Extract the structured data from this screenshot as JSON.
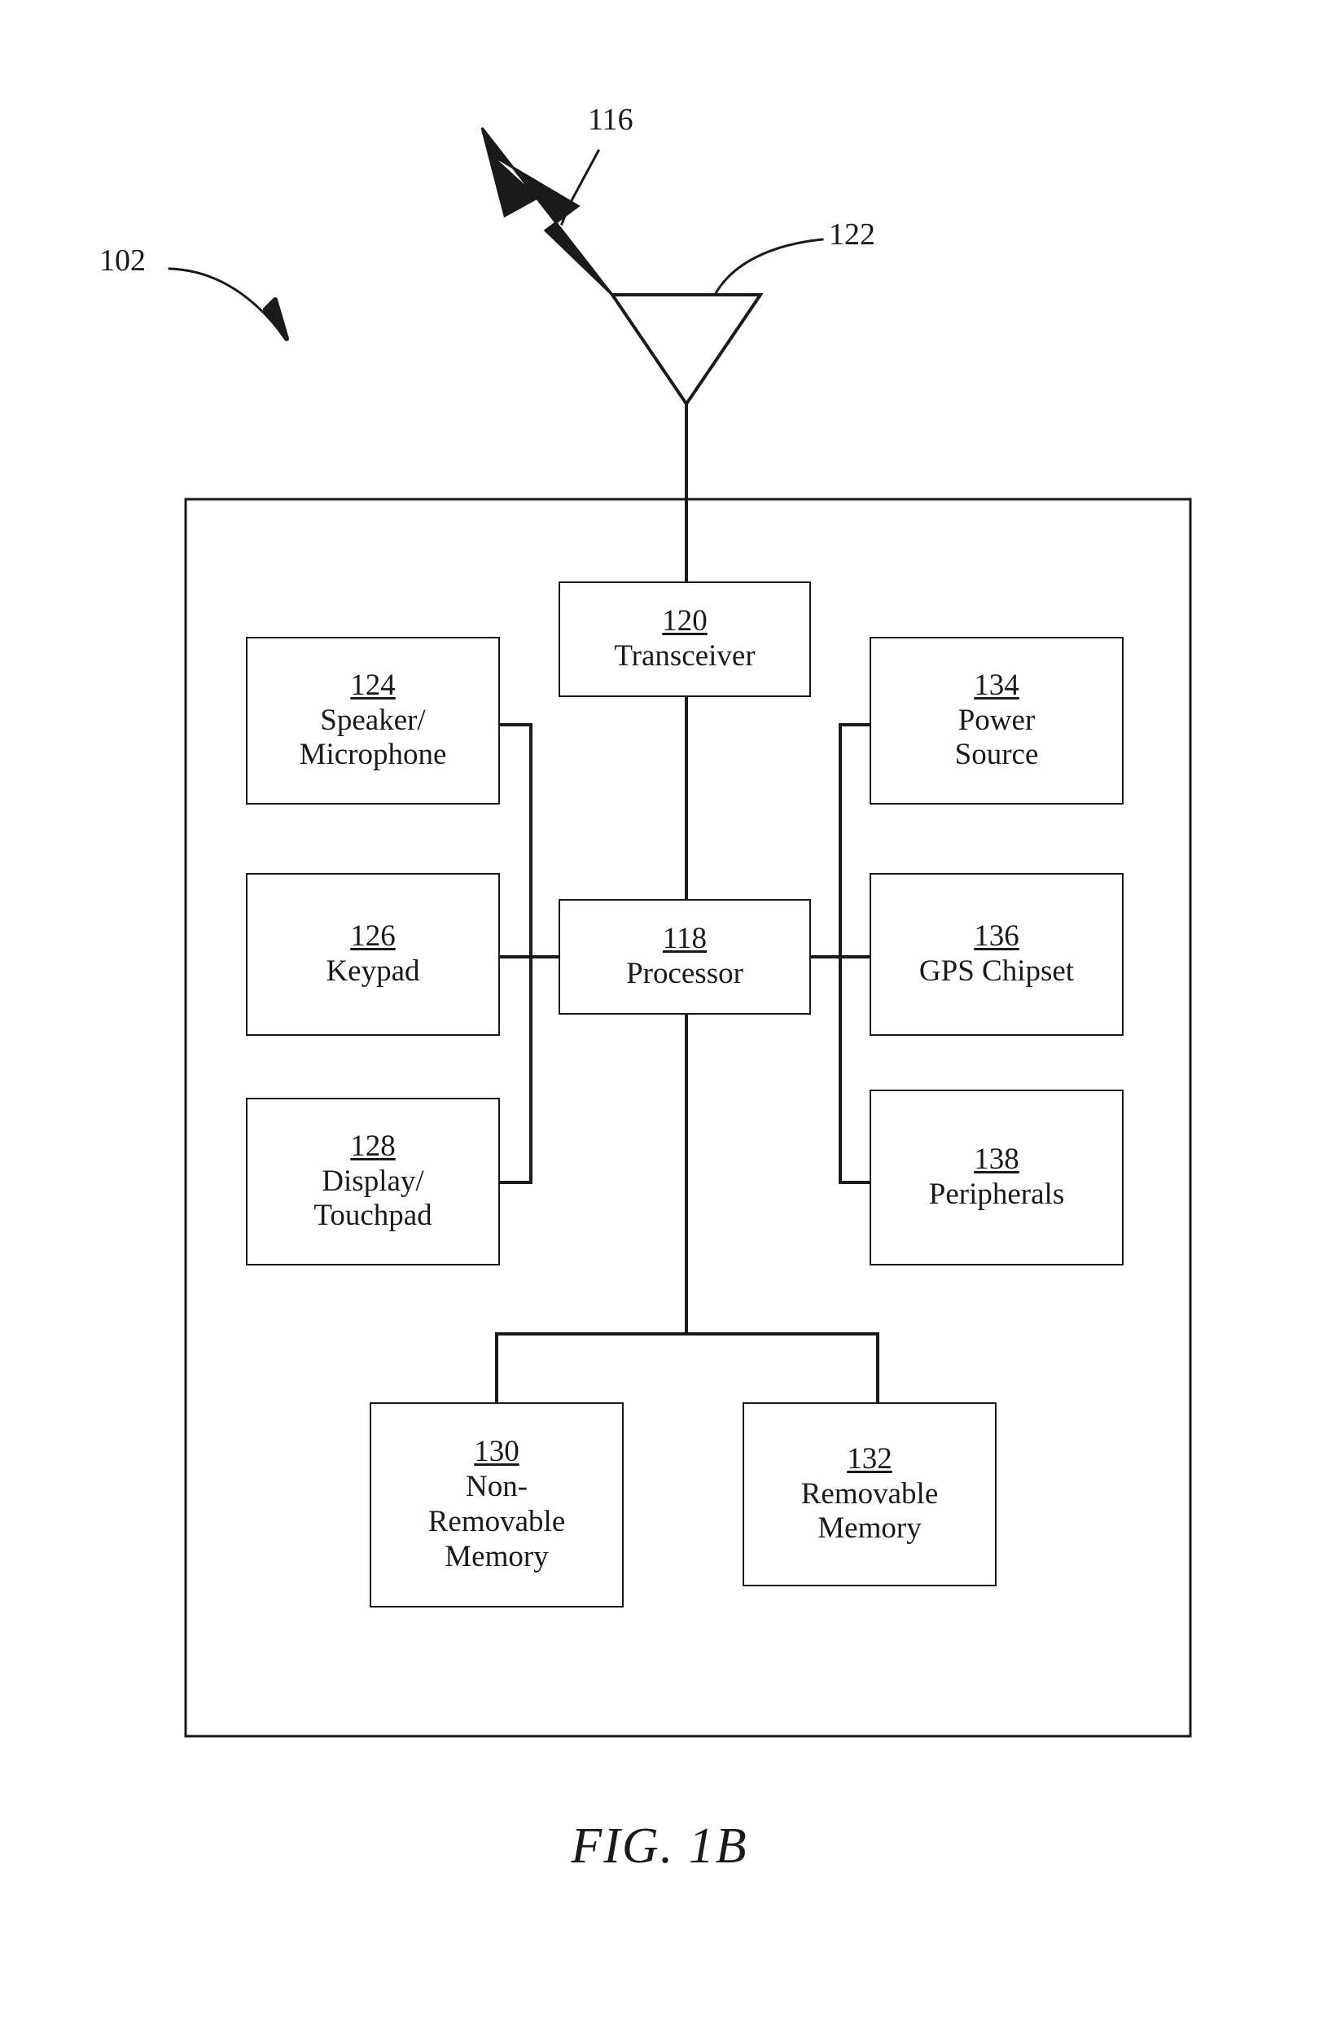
{
  "figure": {
    "caption": "FIG. 1B",
    "device_ref": "102",
    "signal_ref": "116",
    "antenna_ref": "122"
  },
  "blocks": [
    {
      "id": "transceiver",
      "ref": "120",
      "label": "Transceiver"
    },
    {
      "id": "speaker",
      "ref": "124",
      "label": "Speaker/\nMicrophone"
    },
    {
      "id": "keypad",
      "ref": "126",
      "label": "Keypad"
    },
    {
      "id": "display",
      "ref": "128",
      "label": "Display/\nTouchpad"
    },
    {
      "id": "processor",
      "ref": "118",
      "label": "Processor"
    },
    {
      "id": "power",
      "ref": "134",
      "label": "Power\nSource"
    },
    {
      "id": "gps",
      "ref": "136",
      "label": "GPS Chipset"
    },
    {
      "id": "peripherals",
      "ref": "138",
      "label": "Peripherals"
    },
    {
      "id": "nonremovable",
      "ref": "130",
      "label": "Non-\nRemovable\nMemory"
    },
    {
      "id": "removable",
      "ref": "132",
      "label": "Removable\nMemory"
    }
  ],
  "colors": {
    "line": "#1a1a1a",
    "background": "#ffffff"
  }
}
